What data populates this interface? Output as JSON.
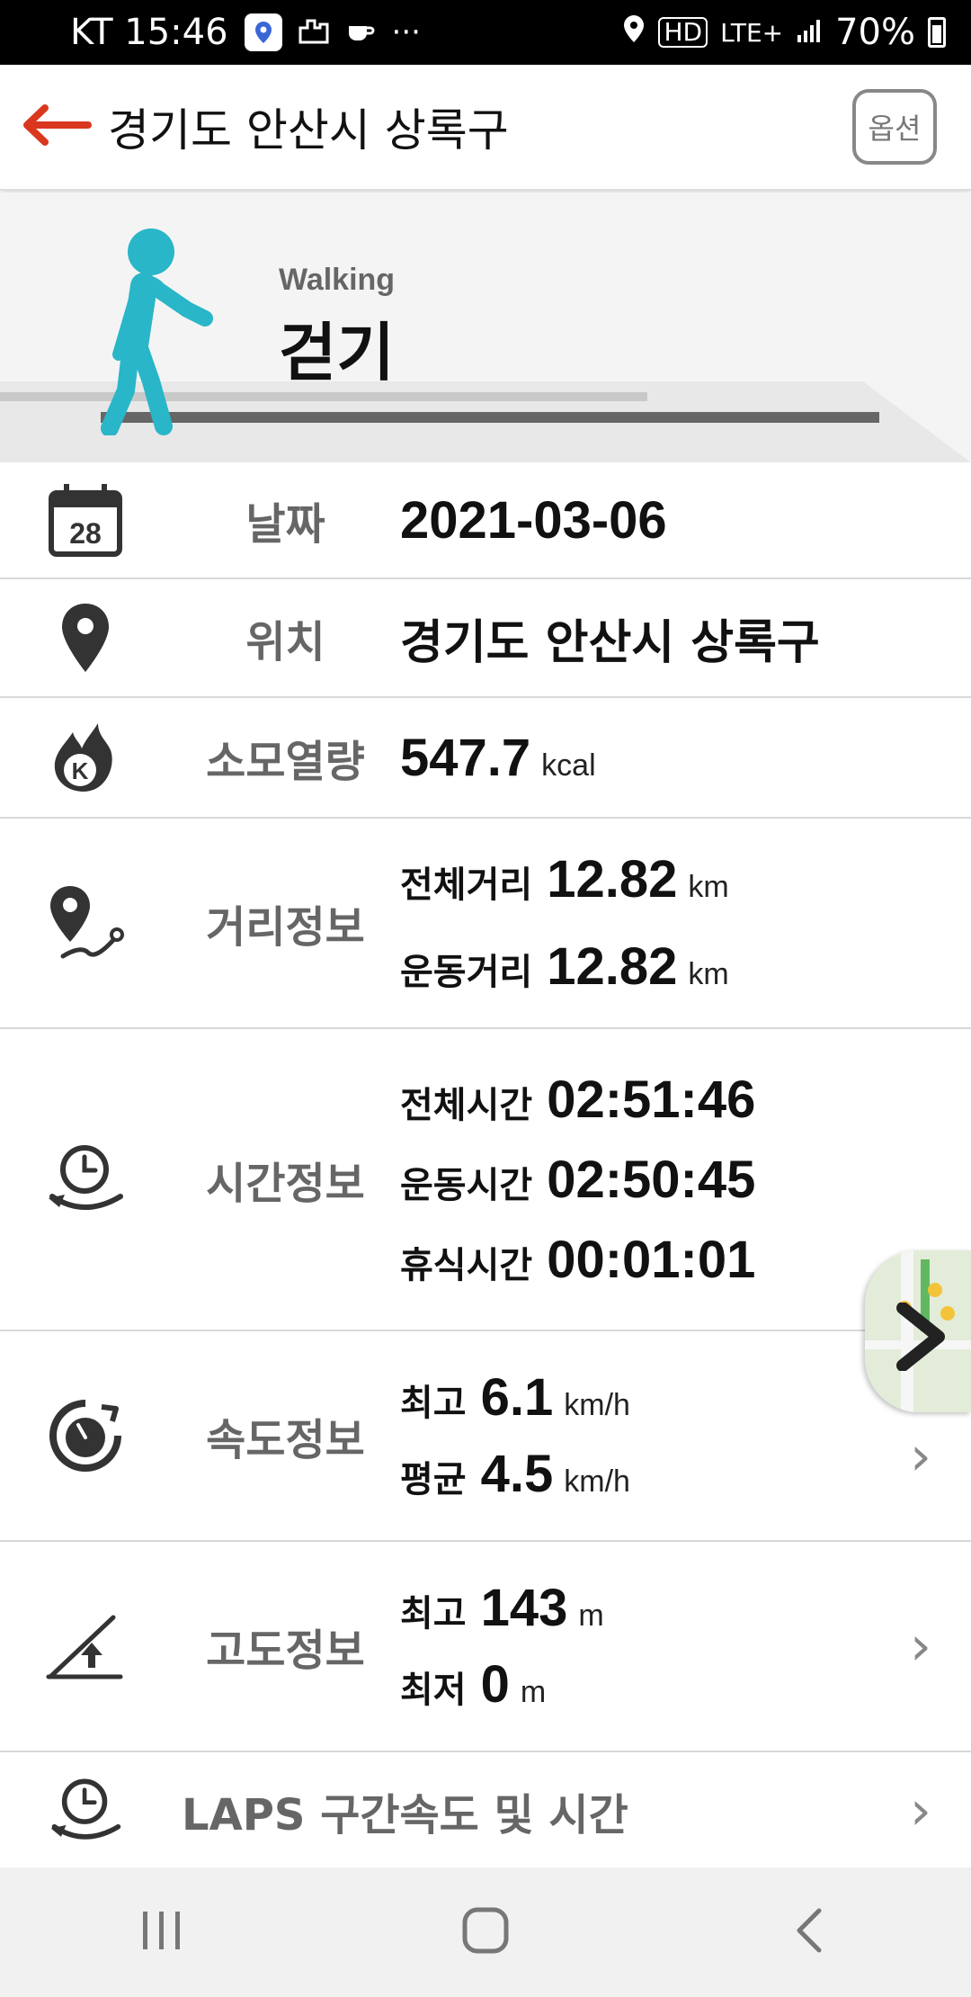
{
  "status_bar": {
    "carrier_time": "KT 15:46",
    "extra_icons": "···",
    "hd": "HD",
    "network": "LTE+",
    "battery": "70%",
    "icons": [
      "map-app-icon",
      "building-icon",
      "cafe-icon",
      "location-icon",
      "signal-icon",
      "battery-icon"
    ]
  },
  "header": {
    "title": "경기도 안산시 상록구",
    "option_label": "옵션",
    "back_icon": "back-arrow-icon",
    "accent": "#d9381e"
  },
  "hero": {
    "subtitle": "Walking",
    "title": "걷기",
    "accent": "#29b6c8"
  },
  "rows": {
    "date": {
      "icon": "calendar-icon",
      "calendar_day": "28",
      "label": "날짜",
      "value": "2021-03-06"
    },
    "location": {
      "icon": "location-pin-icon",
      "label": "위치",
      "value": "경기도 안산시 상록구"
    },
    "calories": {
      "icon": "calorie-flame-icon",
      "label": "소모열량",
      "value": "547.7",
      "unit": "kcal"
    },
    "distance": {
      "icon": "distance-route-icon",
      "label": "거리정보",
      "items": [
        {
          "label": "전체거리",
          "value": "12.82",
          "unit": "km"
        },
        {
          "label": "운동거리",
          "value": "12.82",
          "unit": "km"
        }
      ]
    },
    "time": {
      "icon": "time-clock-icon",
      "label": "시간정보",
      "items": [
        {
          "label": "전체시간",
          "value": "02:51:46"
        },
        {
          "label": "운동시간",
          "value": "02:50:45"
        },
        {
          "label": "휴식시간",
          "value": "00:01:01"
        }
      ]
    },
    "speed": {
      "icon": "speedometer-icon",
      "label": "속도정보",
      "items": [
        {
          "label": "최고",
          "value": "6.1",
          "unit": "km/h"
        },
        {
          "label": "평균",
          "value": "4.5",
          "unit": "km/h"
        }
      ]
    },
    "altitude": {
      "icon": "altitude-slope-icon",
      "label": "고도정보",
      "items": [
        {
          "label": "최고",
          "value": "143",
          "unit": "m"
        },
        {
          "label": "최저",
          "value": "0",
          "unit": "m"
        }
      ]
    },
    "laps": {
      "icon": "laps-clock-icon",
      "label": "LAPS 구간속도 및 시간"
    }
  },
  "map_thumbnail": {
    "icon": "map-expand-icon"
  },
  "nav_bar": {
    "icons": [
      "recent-apps-icon",
      "home-icon",
      "back-icon"
    ]
  }
}
